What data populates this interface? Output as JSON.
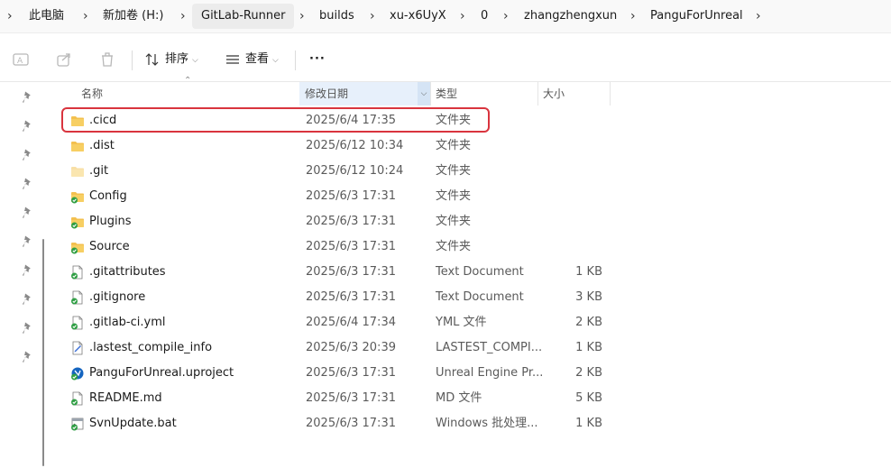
{
  "breadcrumb": {
    "items": [
      "此电脑",
      "新加卷 (H:)",
      "GitLab-Runner",
      "builds",
      "xu-x6UyX",
      "0",
      "zhangzhengxun",
      "PanguForUnreal"
    ]
  },
  "toolbar": {
    "sort_label": "排序",
    "view_label": "查看",
    "more_label": "···"
  },
  "columns": {
    "name": "名称",
    "modified": "修改日期",
    "type": "类型",
    "size": "大小"
  },
  "files": [
    {
      "name": ".cicd",
      "modified": "2025/6/4 17:35",
      "type": "文件夹",
      "size": "",
      "icon": "folder-icon"
    },
    {
      "name": ".dist",
      "modified": "2025/6/12 10:34",
      "type": "文件夹",
      "size": "",
      "icon": "folder-icon"
    },
    {
      "name": ".git",
      "modified": "2025/6/12 10:24",
      "type": "文件夹",
      "size": "",
      "icon": "folder-hidden-icon"
    },
    {
      "name": "Config",
      "modified": "2025/6/3 17:31",
      "type": "文件夹",
      "size": "",
      "icon": "folder-synced-icon"
    },
    {
      "name": "Plugins",
      "modified": "2025/6/3 17:31",
      "type": "文件夹",
      "size": "",
      "icon": "folder-synced-icon"
    },
    {
      "name": "Source",
      "modified": "2025/6/3 17:31",
      "type": "文件夹",
      "size": "",
      "icon": "folder-synced-icon"
    },
    {
      "name": ".gitattributes",
      "modified": "2025/6/3 17:31",
      "type": "Text Document",
      "size": "1 KB",
      "icon": "document-synced-icon"
    },
    {
      "name": ".gitignore",
      "modified": "2025/6/3 17:31",
      "type": "Text Document",
      "size": "3 KB",
      "icon": "document-synced-icon"
    },
    {
      "name": ".gitlab-ci.yml",
      "modified": "2025/6/4 17:34",
      "type": "YML 文件",
      "size": "2 KB",
      "icon": "document-synced-icon"
    },
    {
      "name": ".lastest_compile_info",
      "modified": "2025/6/3 20:39",
      "type": "LASTEST_COMPI...",
      "size": "1 KB",
      "icon": "document-edit-icon"
    },
    {
      "name": "PanguForUnreal.uproject",
      "modified": "2025/6/3 17:31",
      "type": "Unreal Engine Pr...",
      "size": "2 KB",
      "icon": "unreal-project-icon"
    },
    {
      "name": "README.md",
      "modified": "2025/6/3 17:31",
      "type": "MD 文件",
      "size": "5 KB",
      "icon": "document-synced-icon"
    },
    {
      "name": "SvnUpdate.bat",
      "modified": "2025/6/3 17:31",
      "type": "Windows 批处理...",
      "size": "1 KB",
      "icon": "batch-file-icon"
    }
  ],
  "colors": {
    "highlight": "#d9343e",
    "folder": "#f3c04f",
    "sync_green": "#2f9e44"
  }
}
